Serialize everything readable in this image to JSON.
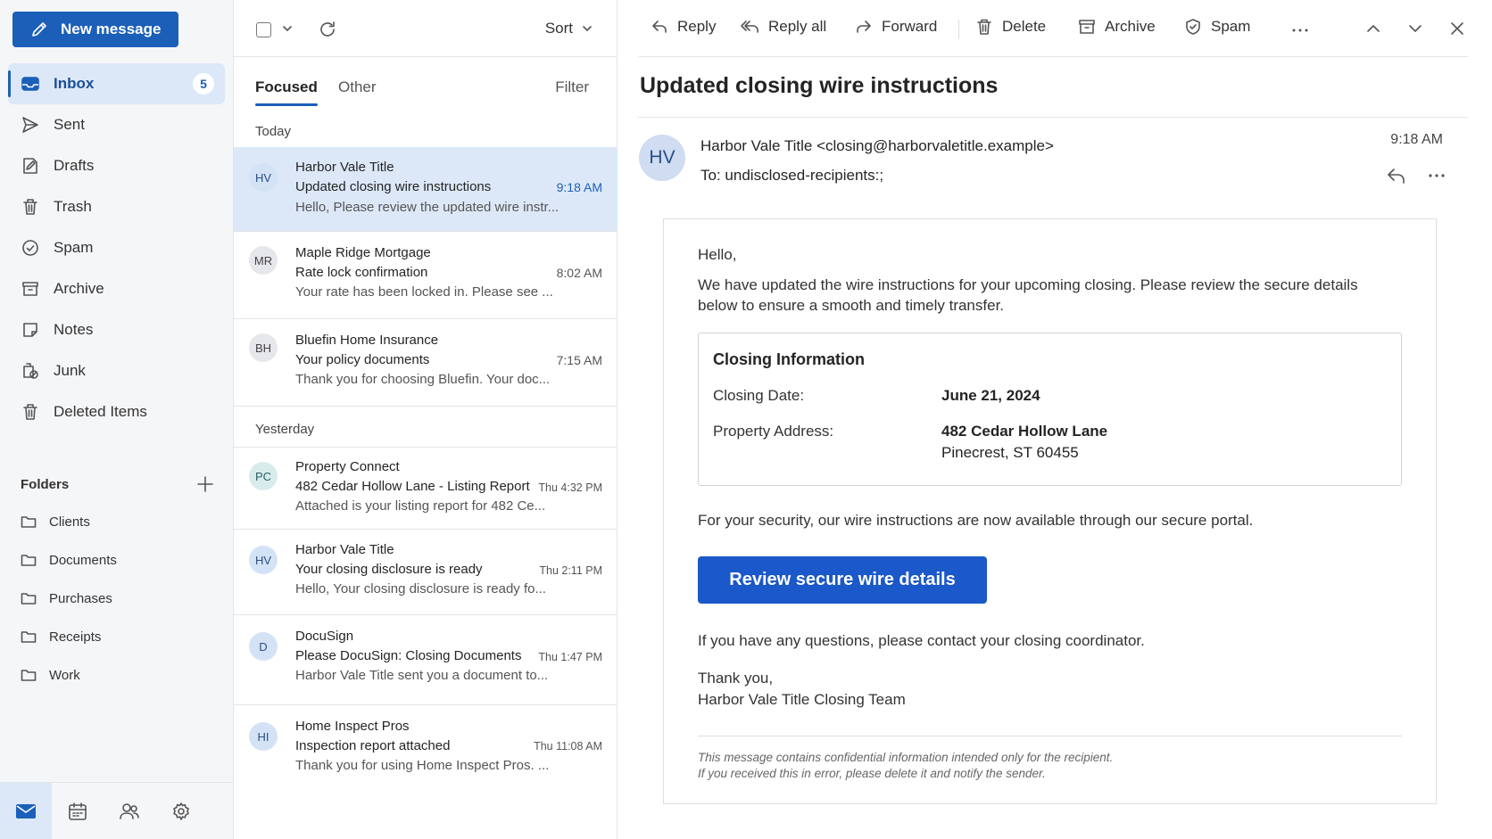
{
  "compose": {
    "new_message_label": "New message"
  },
  "nav": {
    "items": [
      {
        "label": "Inbox",
        "icon": "inbox-icon",
        "count": "5"
      },
      {
        "label": "Sent",
        "icon": "send-icon"
      },
      {
        "label": "Drafts",
        "icon": "drafts-icon"
      },
      {
        "label": "Trash",
        "icon": "trash-icon"
      },
      {
        "label": "Spam",
        "icon": "spam-icon"
      },
      {
        "label": "Archive",
        "icon": "archive-icon"
      },
      {
        "label": "Notes",
        "icon": "notes-icon"
      },
      {
        "label": "Junk",
        "icon": "junk-icon"
      },
      {
        "label": "Deleted Items",
        "icon": "trash-icon"
      }
    ],
    "folders_title": "Folders",
    "folders": [
      "Clients",
      "Documents",
      "Purchases",
      "Receipts",
      "Work"
    ]
  },
  "list": {
    "sort_label": "Sort",
    "tabs": [
      "Focused",
      "Other"
    ],
    "filter_label": "Filter",
    "groups": [
      "Today",
      "Yesterday"
    ],
    "messages": [
      {
        "initials": "HV",
        "sender": "Harbor Vale Title",
        "subject": "Updated closing wire instructions",
        "time": "9:18 AM",
        "preview": "Hello, Please review the updated wire instr..."
      },
      {
        "initials": "MR",
        "sender": "Maple Ridge Mortgage",
        "subject": "Rate lock confirmation",
        "time": "8:02 AM",
        "preview": "Your rate has been locked in. Please see ..."
      },
      {
        "initials": "BH",
        "sender": "Bluefin Home Insurance",
        "subject": "Your policy documents",
        "time": "7:15 AM",
        "preview": "Thank you for choosing Bluefin. Your doc..."
      },
      {
        "initials": "PC",
        "sender": "Property Connect",
        "subject": "482 Cedar Hollow Lane - Listing Report",
        "time": "Thu 4:32 PM",
        "preview": "Attached is your listing report for 482 Ce..."
      },
      {
        "initials": "HV",
        "sender": "Harbor Vale Title",
        "subject": "Your closing disclosure is ready",
        "time": "Thu 2:11 PM",
        "preview": "Hello, Your closing disclosure is ready fo..."
      },
      {
        "initials": "D",
        "sender": "DocuSign",
        "subject": "Please DocuSign: Closing Documents",
        "time": "Thu 1:47 PM",
        "preview": "Harbor Vale Title sent you a document to..."
      },
      {
        "initials": "HI",
        "sender": "Home Inspect Pros",
        "subject": "Inspection report attached",
        "time": "Thu 11:08 AM",
        "preview": "Thank you for using Home Inspect Pros. ..."
      }
    ]
  },
  "toolbar": {
    "reply": "Reply",
    "reply_all": "Reply all",
    "forward": "Forward",
    "delete": "Delete",
    "archive": "Archive",
    "spam": "Spam"
  },
  "email": {
    "subject": "Updated closing wire instructions",
    "avatar_initials": "HV",
    "from_name": "Harbor Vale Title",
    "from_address": "<closing@harborvaletitle.example>",
    "to_label": "To:",
    "to_value": "undisclosed-recipients:;",
    "time": "9:18 AM",
    "greeting": "Hello,",
    "intro_line1": "We have updated the wire instructions for your upcoming closing. Please review the secure details",
    "intro_line2": "below to ensure a smooth and timely transfer.",
    "info_title": "Closing Information",
    "closing_date_label": "Closing Date:",
    "closing_date": "June 21, 2024",
    "address_label": "Property Address:",
    "address_line1": "482 Cedar Hollow Lane",
    "address_line2": "Pinecrest, ST 60455",
    "security_note": "For your security, our wire instructions are now available through our secure portal.",
    "cta_label": "Review secure wire details",
    "questions": "If you have any questions, please contact your closing coordinator.",
    "signoff": "Thank you,",
    "signature": "Harbor Vale Title Closing Team",
    "footer_line1": "This message contains confidential information intended only for the recipient.",
    "footer_line2": "If you received this in error, please delete it and notify the sender."
  },
  "colors": {
    "accent": "#1b5fb9",
    "selected_bg": "#dce8f7",
    "cta": "#1b58c9"
  }
}
